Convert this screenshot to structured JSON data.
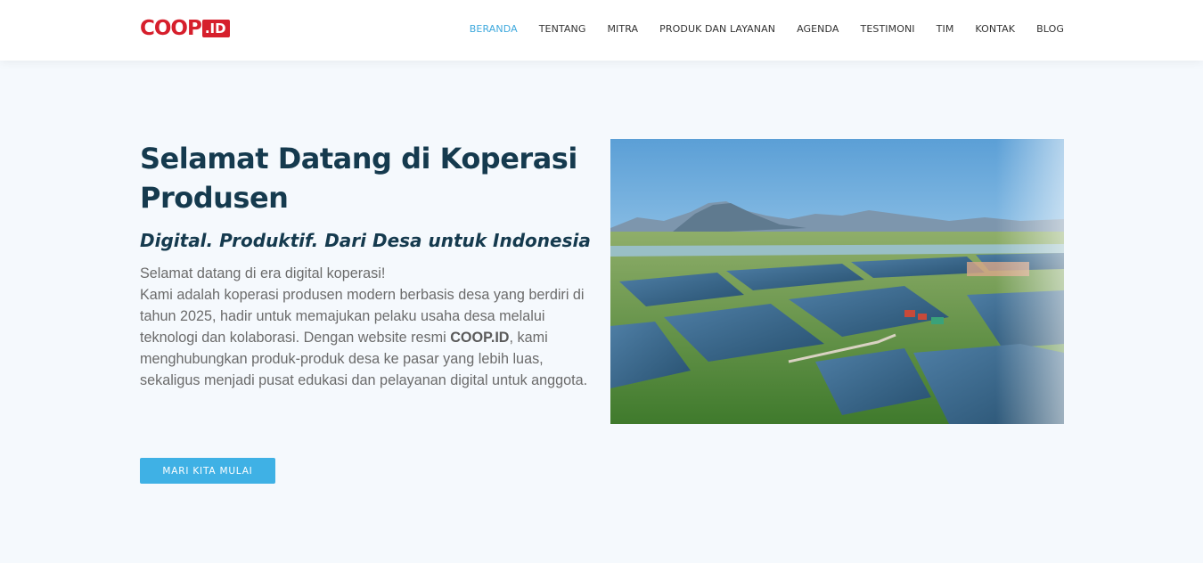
{
  "brand": {
    "logo_main": "COOP",
    "logo_suffix": ".ID",
    "color": "#d61f2c"
  },
  "nav": {
    "items": [
      {
        "label": "BERANDA",
        "active": true
      },
      {
        "label": "TENTANG",
        "active": false
      },
      {
        "label": "MITRA",
        "active": false
      },
      {
        "label": "PRODUK DAN LAYANAN",
        "active": false
      },
      {
        "label": "AGENDA",
        "active": false
      },
      {
        "label": "TESTIMONI",
        "active": false
      },
      {
        "label": "TIM",
        "active": false
      },
      {
        "label": "KONTAK",
        "active": false
      },
      {
        "label": "BLOG",
        "active": false
      }
    ],
    "active_color": "#3fa9dd"
  },
  "hero": {
    "title": "Selamat Datang di Koperasi Produsen",
    "subtitle": "Digital. Produktif. Dari Desa untuk Indonesia",
    "intro_line": "Selamat datang di era digital koperasi!",
    "body_before": "Kami adalah koperasi produsen modern berbasis desa yang berdiri di tahun 2025, hadir untuk memajukan pelaku usaha desa melalui teknologi dan kolaborasi. Dengan website resmi ",
    "body_bold": "COOP.ID",
    "body_after": ", kami menghubungkan produk-produk desa ke pasar yang lebih luas, sekaligus menjadi pusat edukasi dan pelayanan digital untuk anggota.",
    "cta_label": "MARI KITA MULAI",
    "cta_color": "#3fb1e5",
    "image_icon": "aerial-fish-ponds-photo"
  }
}
